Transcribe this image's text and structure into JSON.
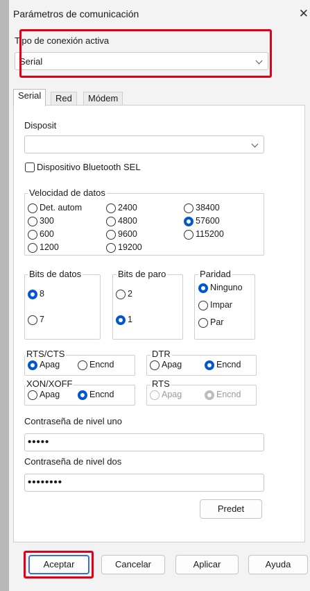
{
  "window": {
    "title": "Parámetros de comunicación",
    "close_glyph": "✕"
  },
  "connection": {
    "label": "Tipo de conexión activa",
    "value": "Serial"
  },
  "tabs": [
    {
      "label": "Serial"
    },
    {
      "label": "Red"
    },
    {
      "label": "Módem"
    }
  ],
  "serial": {
    "device_label": "Disposit",
    "device_value": "",
    "bluetooth_label": "Dispositivo Bluetooth SEL",
    "data_rate": {
      "title": "Velocidad de datos",
      "options": [
        "Det. autom",
        "300",
        "600",
        "1200",
        "2400",
        "4800",
        "9600",
        "19200",
        "38400",
        "57600",
        "115200"
      ],
      "selected": "57600"
    },
    "data_bits": {
      "title": "Bits de datos",
      "options": [
        "8",
        "7"
      ],
      "selected": "8"
    },
    "stop_bits": {
      "title": "Bits de paro",
      "options": [
        "2",
        "1"
      ],
      "selected": "1"
    },
    "parity": {
      "title": "Paridad",
      "options": [
        "Ninguno",
        "Impar",
        "Par"
      ],
      "selected": "Ninguno"
    },
    "rts_cts": {
      "title": "RTS/CTS",
      "off": "Apag",
      "on": "Encnd",
      "selected": "Apag"
    },
    "dtr": {
      "title": "DTR",
      "off": "Apag",
      "on": "Encnd",
      "selected": "Encnd"
    },
    "xon_xoff": {
      "title": "XON/XOFF",
      "off": "Apag",
      "on": "Encnd",
      "selected": "Encnd"
    },
    "rts": {
      "title": "RTS",
      "off": "Apag",
      "on": "Encnd",
      "selected": "Encnd",
      "disabled": true
    },
    "password1": {
      "label": "Contraseña de nivel uno",
      "value": "•••••"
    },
    "password2": {
      "label": "Contraseña de nivel dos",
      "value": "••••••••"
    },
    "defaults_button": "Predet"
  },
  "buttons": {
    "ok": "Aceptar",
    "cancel": "Cancelar",
    "apply": "Aplicar",
    "help": "Ayuda"
  },
  "colors": {
    "accent": "#0057d0",
    "highlight": "#e0001a"
  }
}
